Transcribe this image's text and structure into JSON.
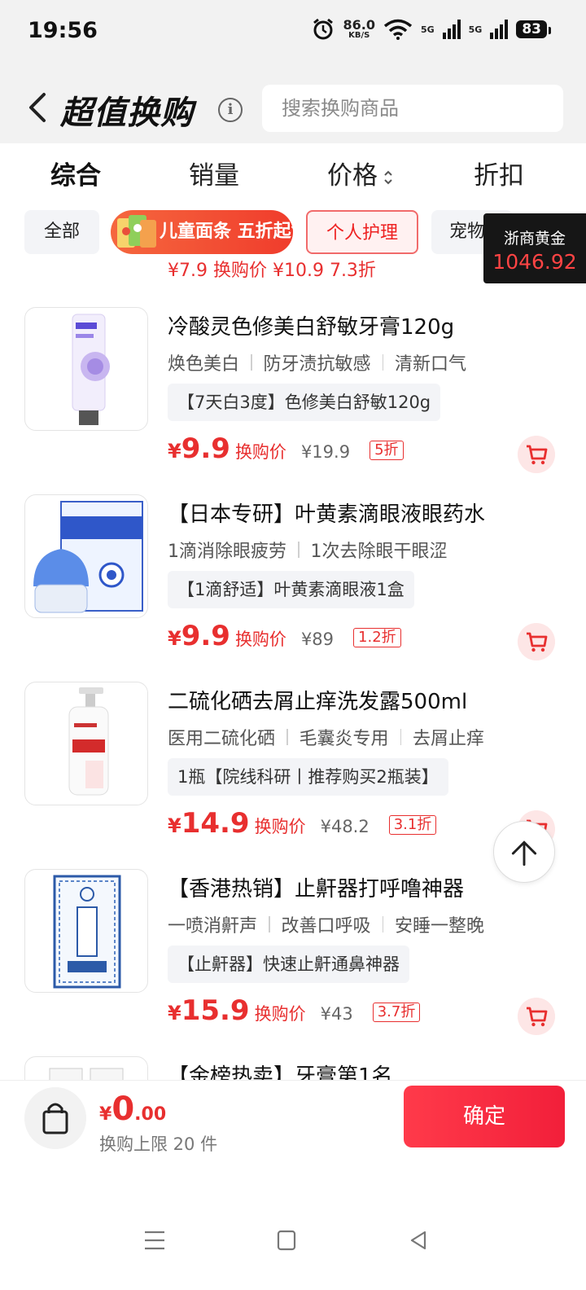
{
  "status_bar": {
    "time": "19:56",
    "net_speed": "86.0",
    "net_speed_unit": "KB/S",
    "signal_1": "5G",
    "signal_2": "5G",
    "battery": "83"
  },
  "header": {
    "title": "超值换购",
    "search_placeholder": "搜索换购商品"
  },
  "sort_tabs": [
    {
      "label": "综合",
      "active": true
    },
    {
      "label": "销量",
      "active": false
    },
    {
      "label": "价格",
      "active": false
    },
    {
      "label": "折扣",
      "active": false
    }
  ],
  "categories": {
    "all": "全部",
    "promo": "儿童面条 五折起售",
    "care": "个人护理",
    "pet": "宠物"
  },
  "gold_widget": {
    "label": "浙商黄金",
    "value": "1046.92"
  },
  "partial_top_row": "¥7.9 换购价  ¥10.9  7.3折",
  "products": [
    {
      "name": "冷酸灵色修美白舒敏牙膏120g",
      "tags": [
        "焕色美白",
        "防牙渍抗敏感",
        "清新口气"
      ],
      "spec": "【7天白3度】色修美白舒敏120g",
      "price_symbol": "¥",
      "price": "9.9",
      "price_label": "换购价",
      "original_price": "¥19.9",
      "discount": "5折"
    },
    {
      "name": "【日本专研】叶黄素滴眼液眼药水",
      "tags": [
        "1滴消除眼疲劳",
        "1次去除眼干眼涩"
      ],
      "spec": "【1滴舒适】叶黄素滴眼液1盒",
      "price_symbol": "¥",
      "price": "9.9",
      "price_label": "换购价",
      "original_price": "¥89",
      "discount": "1.2折"
    },
    {
      "name": "二硫化硒去屑止痒洗发露500ml",
      "tags": [
        "医用二硫化硒",
        "毛囊炎专用",
        "去屑止痒"
      ],
      "spec": "1瓶【院线科研丨推荐购买2瓶装】",
      "price_symbol": "¥",
      "price": "14.9",
      "price_label": "换购价",
      "original_price": "¥48.2",
      "discount": "3.1折"
    },
    {
      "name": "【香港热销】止鼾器打呼噜神器",
      "tags": [
        "一喷消鼾声",
        "改善口呼吸",
        "安睡一整晚"
      ],
      "spec": "【止鼾器】快速止鼾通鼻神器",
      "price_symbol": "¥",
      "price": "15.9",
      "price_label": "换购价",
      "original_price": "¥43",
      "discount": "3.7折"
    },
    {
      "name": "【金榜热卖】牙膏第1名",
      "tags": [],
      "spec": "",
      "price_symbol": "",
      "price": "",
      "price_label": "",
      "original_price": "",
      "discount": ""
    }
  ],
  "bottom": {
    "currency": "¥",
    "total_int": "0",
    "total_dec": ".00",
    "limit_text": "换购上限 20 件",
    "confirm_label": "确定"
  },
  "colors": {
    "accent_red": "#e82f2f",
    "button_red": "#f21f3a",
    "chip_bg": "#f3f4f7"
  }
}
